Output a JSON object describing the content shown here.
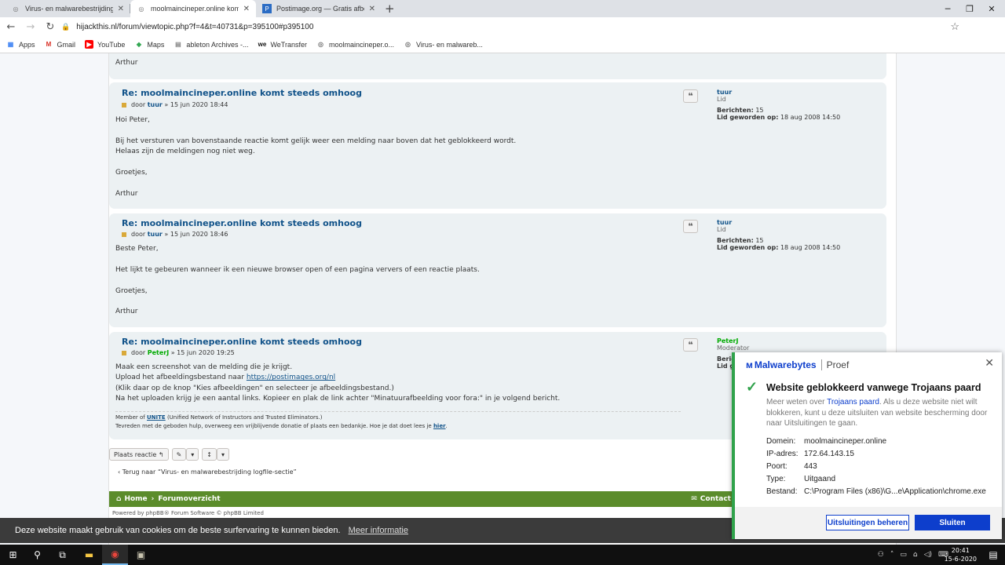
{
  "browser": {
    "tabs": [
      {
        "label": "Virus- en malwarebestrijding logf",
        "active": false
      },
      {
        "label": "moolmaincineper.online komt ste",
        "active": true
      },
      {
        "label": "Postimage.org — Gratis afbeeldin",
        "active": false
      }
    ],
    "new_tab": "+",
    "url": "hijackthis.nl/forum/viewtopic.php?f=4&t=40731&p=395100#p395100",
    "bookmarks": [
      "Apps",
      "Gmail",
      "YouTube",
      "Maps",
      "ableton Archives -...",
      "WeTransfer",
      "moolmaincineper.o...",
      "Virus- en malwareb..."
    ]
  },
  "forum": {
    "top_signoff": "Arthur",
    "posts": [
      {
        "title": "Re: moolmaincineper.online komt steeds omhoog",
        "meta_prefix": "door",
        "author": "tuur",
        "date": "» 15 jun 2020 18:44",
        "body": [
          "Hoi Peter,",
          "",
          "Bij het versturen van bovenstaande reactie komt gelijk weer een melding naar boven dat het geblokkeerd wordt.",
          "Helaas zijn de meldingen nog niet weg.",
          "",
          "Groetjes,",
          "",
          "Arthur"
        ],
        "profile": {
          "username": "tuur",
          "rank": "Lid",
          "posts_label": "Berichten:",
          "posts": "15",
          "joined_label": "Lid geworden op:",
          "joined": "18 aug 2008 14:50"
        }
      },
      {
        "title": "Re: moolmaincineper.online komt steeds omhoog",
        "meta_prefix": "door",
        "author": "tuur",
        "date": "» 15 jun 2020 18:46",
        "body": [
          "Beste Peter,",
          "",
          "Het lijkt te gebeuren wanneer ik een nieuwe browser open of een pagina ververs of een reactie plaats.",
          "",
          "Groetjes,",
          "",
          "Arthur"
        ],
        "profile": {
          "username": "tuur",
          "rank": "Lid",
          "posts_label": "Berichten:",
          "posts": "15",
          "joined_label": "Lid geworden op:",
          "joined": "18 aug 2008 14:50"
        }
      },
      {
        "title": "Re: moolmaincineper.online komt steeds omhoog",
        "meta_prefix": "door",
        "author": "PeterJ",
        "date": "» 15 jun 2020 19:25",
        "body_line1": "Maak een screenshot van de melding die je krijgt.",
        "body_line2_prefix": "Upload het afbeeldingsbestand naar ",
        "body_link": "https://postimages.org/nl",
        "body_line3": "(Klik daar op de knop \"Kies afbeeldingen\" en selecteer je afbeeldingsbestand.)",
        "body_line4": "Na het uploaden krijg je een aantal links. Kopieer en plak de link achter \"Minatuurafbeelding voor fora:\" in je volgend bericht.",
        "sig_prefix": "Member of ",
        "sig_link": "UNITE",
        "sig_rest": " (Unified Network of Instructors and Trusted Eliminators.)",
        "sig_line2": "Tevreden met de geboden hulp, overweeg een vrijblijvende donatie of plaats een bedankje. Hoe je dat doet lees je ",
        "sig_line2_link": "hier",
        "sig_line2_end": ".",
        "profile": {
          "username": "PeterJ",
          "rank": "Moderator",
          "posts_label": "Bericht",
          "joined_label": "Lid ge"
        }
      }
    ],
    "actions": {
      "reply": "Plaats reactie",
      "reply_icon": "↰",
      "tools_icon": "✎",
      "sort_icon": "↕"
    },
    "back_link": "‹  Terug naar “Virus- en malwarebestrijding logfile-sectie”",
    "footer": {
      "home": "Home",
      "overview": "Forumoverzicht",
      "contact": "Contact"
    },
    "powered": "Powered by phpBB® Forum Software © phpBB Limited",
    "cookie_text": "Deze website maakt gebruik van cookies om de beste surfervaring te kunnen bieden.",
    "cookie_link": "Meer informatie"
  },
  "toast": {
    "brand": "Malwarebytes",
    "edition": "Proef",
    "title": "Website geblokkeerd vanwege Trojaans paard",
    "desc_pre": "Meer weten over ",
    "desc_link": "Trojaans paard",
    "desc_post": ". Als u deze website niet wilt blokkeren, kunt u deze uitsluiten van website bescherming door naar Uitsluitingen te gaan.",
    "fields": [
      {
        "k": "Domein:",
        "v": "moolmaincineper.online"
      },
      {
        "k": "IP-adres:",
        "v": "172.64.143.15"
      },
      {
        "k": "Poort:",
        "v": "443"
      },
      {
        "k": "Type:",
        "v": "Uitgaand"
      },
      {
        "k": "Bestand:",
        "v": "C:\\Program Files (x86)\\G...e\\Application\\chrome.exe"
      }
    ],
    "btn_exclusions": "Uitsluitingen beheren",
    "btn_close": "Sluiten"
  },
  "taskbar": {
    "time": "20:41",
    "date": "15-6-2020"
  },
  "colors": {
    "accent": "#105289",
    "moderator": "#00aa00",
    "footer": "#5b8c2b",
    "malwarebytes": "#0d3ecc",
    "success": "#30a24b"
  }
}
